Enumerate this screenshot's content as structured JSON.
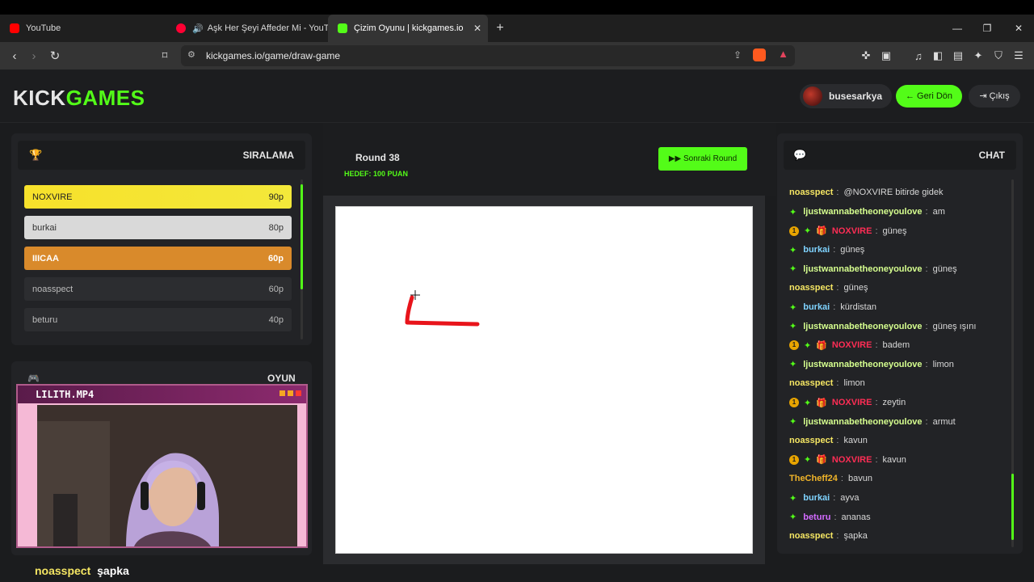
{
  "browser": {
    "tabs": [
      {
        "title": "YouTube",
        "fav": "#ff0000"
      },
      {
        "title": "Aşk Her Şeyi Affeder Mi - YouTub",
        "fav": "#ff0033"
      },
      {
        "title": "Çizim Oyunu | kickgames.io",
        "fav": "#53fc18"
      }
    ],
    "url": "kickgames.io/game/draw-game"
  },
  "header": {
    "logo_a": "KICK",
    "logo_b": "GAMES",
    "username": "busesarkya",
    "back_label": "← Geri Dön",
    "exit_label": "Çıkış"
  },
  "leaderboard": {
    "title": "SIRALAMA",
    "rows": [
      {
        "name": "NOXVIRE",
        "score": "90p"
      },
      {
        "name": "burkai",
        "score": "80p"
      },
      {
        "name": "IIICAA",
        "score": "60p"
      },
      {
        "name": "noasspect",
        "score": "60p"
      },
      {
        "name": "beturu",
        "score": "40p"
      }
    ]
  },
  "game_panel": {
    "title": "OYUN"
  },
  "webcam": {
    "title": "LILITH.MP4"
  },
  "round": {
    "label": "Round 38",
    "target": "HEDEF: 100 PUAN",
    "next_label": "Sonraki Round"
  },
  "chat": {
    "title": "CHAT",
    "messages": [
      {
        "user": "noasspect",
        "color": "#f5e663",
        "badges": "",
        "text": "@NOXVIRE bitirde gidek"
      },
      {
        "user": "ljustwannabetheoneyoulove",
        "color": "#d6ff8f",
        "badges": "dia",
        "text": "am"
      },
      {
        "user": "NOXVIRE",
        "color": "#ff2d55",
        "badges": "full",
        "text": "güneş"
      },
      {
        "user": "burkai",
        "color": "#7fd3ff",
        "badges": "dia",
        "text": "güneş"
      },
      {
        "user": "ljustwannabetheoneyoulove",
        "color": "#d6ff8f",
        "badges": "dia",
        "text": "güneş"
      },
      {
        "user": "noasspect",
        "color": "#f5e663",
        "badges": "",
        "text": "güneş"
      },
      {
        "user": "burkai",
        "color": "#7fd3ff",
        "badges": "dia",
        "text": "kürdistan"
      },
      {
        "user": "ljustwannabetheoneyoulove",
        "color": "#d6ff8f",
        "badges": "dia",
        "text": "güneş ışını"
      },
      {
        "user": "NOXVIRE",
        "color": "#ff2d55",
        "badges": "full",
        "text": "badem"
      },
      {
        "user": "ljustwannabetheoneyoulove",
        "color": "#d6ff8f",
        "badges": "dia",
        "text": "limon"
      },
      {
        "user": "noasspect",
        "color": "#f5e663",
        "badges": "",
        "text": "limon"
      },
      {
        "user": "NOXVIRE",
        "color": "#ff2d55",
        "badges": "full",
        "text": "zeytin"
      },
      {
        "user": "ljustwannabetheoneyoulove",
        "color": "#d6ff8f",
        "badges": "dia",
        "text": "armut"
      },
      {
        "user": "noasspect",
        "color": "#f5e663",
        "badges": "",
        "text": "kavun"
      },
      {
        "user": "NOXVIRE",
        "color": "#ff2d55",
        "badges": "full",
        "text": "kavun"
      },
      {
        "user": "TheCheff24",
        "color": "#f0b429",
        "badges": "",
        "text": "bavun"
      },
      {
        "user": "burkai",
        "color": "#7fd3ff",
        "badges": "dia",
        "text": "ayva"
      },
      {
        "user": "beturu",
        "color": "#d36bff",
        "badges": "dia",
        "text": "ananas"
      },
      {
        "user": "noasspect",
        "color": "#f5e663",
        "badges": "",
        "text": "şapka"
      }
    ]
  },
  "caption": {
    "user": "noasspect",
    "text": "şapka"
  },
  "colors": {
    "accent": "#53fc18",
    "stroke": "#e8141b"
  }
}
